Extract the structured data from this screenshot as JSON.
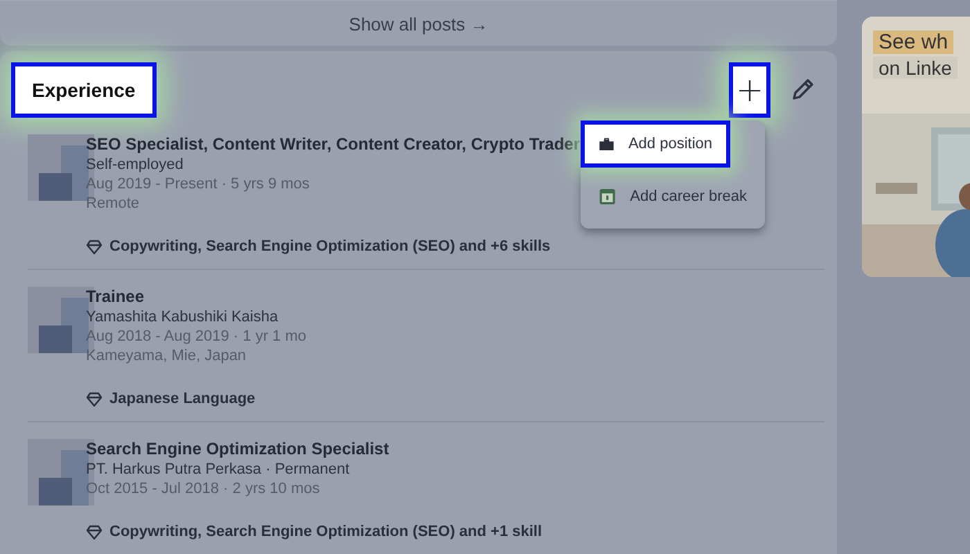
{
  "posts_link": {
    "label": "Show all posts →"
  },
  "experience": {
    "title": "Experience",
    "title_highlighted": true,
    "add_button": {
      "label": "+",
      "highlighted": true
    },
    "menu": [
      {
        "kind": "position",
        "label": "Add position",
        "highlighted": true
      },
      {
        "kind": "break",
        "label": "Add career break",
        "highlighted": false
      }
    ],
    "entries": [
      {
        "title": "SEO Specialist, Content Writer, Content Creator, Crypto Trader",
        "company": "Self-employed",
        "dates": "Aug 2019 - Present · 5 yrs 9 mos",
        "location": "Remote",
        "skills": "Copywriting, Search Engine Optimization (SEO) and +6 skills"
      },
      {
        "title": "Trainee",
        "company": "Yamashita Kabushiki Kaisha",
        "dates": "Aug 2018 - Aug 2019 · 1 yr 1 mo",
        "location": "Kameyama, Mie, Japan",
        "skills": "Japanese Language"
      },
      {
        "title": "Search Engine Optimization Specialist",
        "company": "PT. Harkus Putra Perkasa · Permanent",
        "dates": "Oct 2015 - Jul 2018 · 2 yrs 10 mos",
        "skills": "Copywriting, Search Engine Optimization (SEO) and +1 skill"
      }
    ]
  },
  "ad": {
    "lines": [
      "See wh",
      "on Linke"
    ]
  }
}
